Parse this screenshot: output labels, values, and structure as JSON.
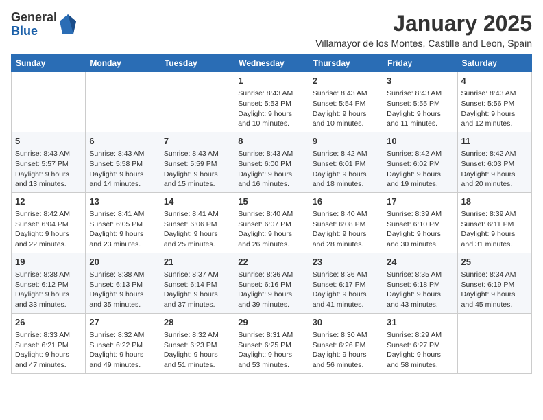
{
  "logo": {
    "general": "General",
    "blue": "Blue"
  },
  "header": {
    "month": "January 2025",
    "location": "Villamayor de los Montes, Castille and Leon, Spain"
  },
  "weekdays": [
    "Sunday",
    "Monday",
    "Tuesday",
    "Wednesday",
    "Thursday",
    "Friday",
    "Saturday"
  ],
  "weeks": [
    [
      {
        "day": "",
        "info": ""
      },
      {
        "day": "",
        "info": ""
      },
      {
        "day": "",
        "info": ""
      },
      {
        "day": "1",
        "info": "Sunrise: 8:43 AM\nSunset: 5:53 PM\nDaylight: 9 hours and 10 minutes."
      },
      {
        "day": "2",
        "info": "Sunrise: 8:43 AM\nSunset: 5:54 PM\nDaylight: 9 hours and 10 minutes."
      },
      {
        "day": "3",
        "info": "Sunrise: 8:43 AM\nSunset: 5:55 PM\nDaylight: 9 hours and 11 minutes."
      },
      {
        "day": "4",
        "info": "Sunrise: 8:43 AM\nSunset: 5:56 PM\nDaylight: 9 hours and 12 minutes."
      }
    ],
    [
      {
        "day": "5",
        "info": "Sunrise: 8:43 AM\nSunset: 5:57 PM\nDaylight: 9 hours and 13 minutes."
      },
      {
        "day": "6",
        "info": "Sunrise: 8:43 AM\nSunset: 5:58 PM\nDaylight: 9 hours and 14 minutes."
      },
      {
        "day": "7",
        "info": "Sunrise: 8:43 AM\nSunset: 5:59 PM\nDaylight: 9 hours and 15 minutes."
      },
      {
        "day": "8",
        "info": "Sunrise: 8:43 AM\nSunset: 6:00 PM\nDaylight: 9 hours and 16 minutes."
      },
      {
        "day": "9",
        "info": "Sunrise: 8:42 AM\nSunset: 6:01 PM\nDaylight: 9 hours and 18 minutes."
      },
      {
        "day": "10",
        "info": "Sunrise: 8:42 AM\nSunset: 6:02 PM\nDaylight: 9 hours and 19 minutes."
      },
      {
        "day": "11",
        "info": "Sunrise: 8:42 AM\nSunset: 6:03 PM\nDaylight: 9 hours and 20 minutes."
      }
    ],
    [
      {
        "day": "12",
        "info": "Sunrise: 8:42 AM\nSunset: 6:04 PM\nDaylight: 9 hours and 22 minutes."
      },
      {
        "day": "13",
        "info": "Sunrise: 8:41 AM\nSunset: 6:05 PM\nDaylight: 9 hours and 23 minutes."
      },
      {
        "day": "14",
        "info": "Sunrise: 8:41 AM\nSunset: 6:06 PM\nDaylight: 9 hours and 25 minutes."
      },
      {
        "day": "15",
        "info": "Sunrise: 8:40 AM\nSunset: 6:07 PM\nDaylight: 9 hours and 26 minutes."
      },
      {
        "day": "16",
        "info": "Sunrise: 8:40 AM\nSunset: 6:08 PM\nDaylight: 9 hours and 28 minutes."
      },
      {
        "day": "17",
        "info": "Sunrise: 8:39 AM\nSunset: 6:10 PM\nDaylight: 9 hours and 30 minutes."
      },
      {
        "day": "18",
        "info": "Sunrise: 8:39 AM\nSunset: 6:11 PM\nDaylight: 9 hours and 31 minutes."
      }
    ],
    [
      {
        "day": "19",
        "info": "Sunrise: 8:38 AM\nSunset: 6:12 PM\nDaylight: 9 hours and 33 minutes."
      },
      {
        "day": "20",
        "info": "Sunrise: 8:38 AM\nSunset: 6:13 PM\nDaylight: 9 hours and 35 minutes."
      },
      {
        "day": "21",
        "info": "Sunrise: 8:37 AM\nSunset: 6:14 PM\nDaylight: 9 hours and 37 minutes."
      },
      {
        "day": "22",
        "info": "Sunrise: 8:36 AM\nSunset: 6:16 PM\nDaylight: 9 hours and 39 minutes."
      },
      {
        "day": "23",
        "info": "Sunrise: 8:36 AM\nSunset: 6:17 PM\nDaylight: 9 hours and 41 minutes."
      },
      {
        "day": "24",
        "info": "Sunrise: 8:35 AM\nSunset: 6:18 PM\nDaylight: 9 hours and 43 minutes."
      },
      {
        "day": "25",
        "info": "Sunrise: 8:34 AM\nSunset: 6:19 PM\nDaylight: 9 hours and 45 minutes."
      }
    ],
    [
      {
        "day": "26",
        "info": "Sunrise: 8:33 AM\nSunset: 6:21 PM\nDaylight: 9 hours and 47 minutes."
      },
      {
        "day": "27",
        "info": "Sunrise: 8:32 AM\nSunset: 6:22 PM\nDaylight: 9 hours and 49 minutes."
      },
      {
        "day": "28",
        "info": "Sunrise: 8:32 AM\nSunset: 6:23 PM\nDaylight: 9 hours and 51 minutes."
      },
      {
        "day": "29",
        "info": "Sunrise: 8:31 AM\nSunset: 6:25 PM\nDaylight: 9 hours and 53 minutes."
      },
      {
        "day": "30",
        "info": "Sunrise: 8:30 AM\nSunset: 6:26 PM\nDaylight: 9 hours and 56 minutes."
      },
      {
        "day": "31",
        "info": "Sunrise: 8:29 AM\nSunset: 6:27 PM\nDaylight: 9 hours and 58 minutes."
      },
      {
        "day": "",
        "info": ""
      }
    ]
  ]
}
